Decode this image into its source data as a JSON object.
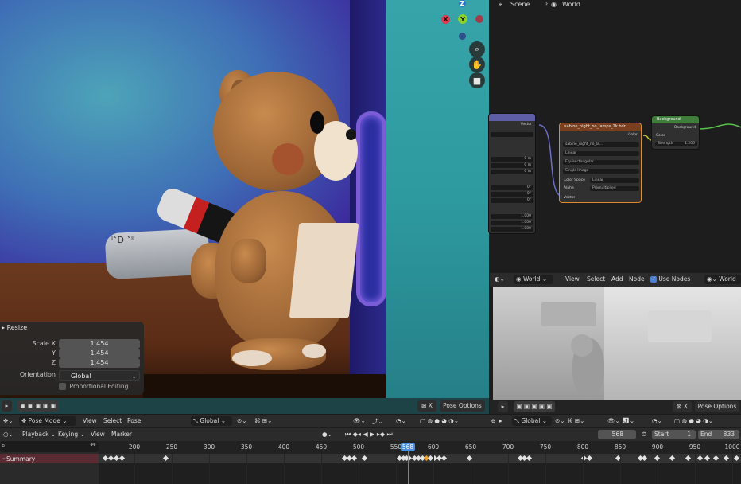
{
  "viewport": {
    "gizmo": {
      "z": "Z",
      "y": "Y",
      "x": "X"
    },
    "tube_text": "ᴵ˂D ˂ᴵᴵ",
    "resize_panel": {
      "title": "Resize",
      "scale_x_label": "Scale X",
      "scale_x": "1.454",
      "y_label": "Y",
      "y": "1.454",
      "z_label": "Z",
      "z": "1.454",
      "orientation_label": "Orientation",
      "orientation": "Global",
      "proportional_editing": "Proportional Editing"
    },
    "pose_options": "Pose Options"
  },
  "node_editor": {
    "breadcrumb": [
      "Scene",
      "World"
    ],
    "texture_node": {
      "title": "sabine_night_no_lamps_2k.hdr",
      "image": "sabine_night_no_la...",
      "interpolation": "Linear",
      "projection": "Equirectangular",
      "source": "Single Image",
      "color_space_label": "Color Space",
      "color_space": "Linear",
      "alpha_label": "Alpha",
      "alpha": "Premultiplied",
      "color_out": "Color",
      "vector_in": "Vector"
    },
    "mapping_node": {
      "vector_out": "Vector",
      "values": [
        "0 m",
        "0 m",
        "0 m",
        "0°",
        "0°",
        "0°",
        "1.000",
        "1.000",
        "1.000"
      ]
    },
    "background_node": {
      "title": "Background",
      "out": "Background",
      "color_in": "Color",
      "strength_label": "Strength",
      "strength": "1.200"
    },
    "header": {
      "world_type": "World",
      "menu": [
        "View",
        "Select",
        "Add",
        "Node"
      ],
      "use_nodes": "Use Nodes",
      "world_name": "World"
    },
    "preview_pose_options": "Pose Options"
  },
  "header_row": {
    "mode": "Pose Mode",
    "menu": [
      "View",
      "Select",
      "Pose"
    ],
    "orientation": "Global",
    "right_orientation": "Global"
  },
  "timeline": {
    "menu": [
      "Playback",
      "Keying",
      "View",
      "Marker"
    ],
    "current_frame": "568",
    "start_label": "Start",
    "start": "1",
    "end_label": "End",
    "end": "833",
    "summary": "Summary",
    "ticks": [
      "200",
      "250",
      "300",
      "350",
      "400",
      "450",
      "500",
      "550",
      "600",
      "650",
      "700",
      "750",
      "800",
      "850",
      "900",
      "950",
      "1000"
    ],
    "playhead": "568"
  }
}
